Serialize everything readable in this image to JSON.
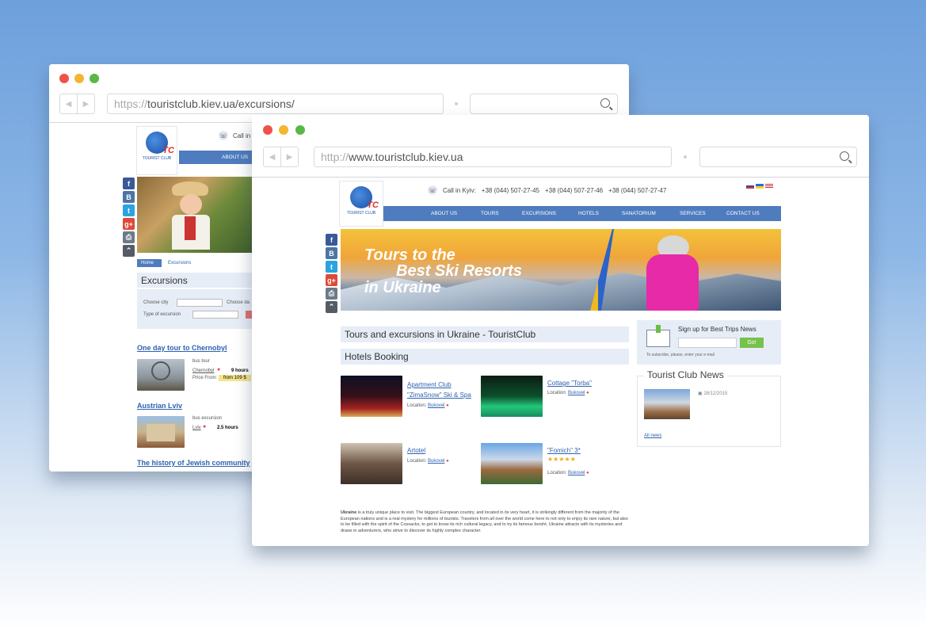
{
  "back_window": {
    "url_proto": "https://",
    "url_rest": "touristclub.kiev.ua/excursions/",
    "logo_text": "TOURIST CLUB",
    "call_label": "Call in",
    "menu": [
      "ABOUT US"
    ],
    "breadcrumb": {
      "home": "Home",
      "current": "Excursions"
    },
    "page_title": "Excursions",
    "filters": {
      "city_label": "Choose city",
      "date_label": "Choose da",
      "type_label": "Type of excursion"
    },
    "tours": [
      {
        "title": "One day tour to Chernobyl",
        "kind": "bus tour",
        "city": "Chernobyl",
        "duration": "9 hours",
        "price_label": "Price From:",
        "price": "from 109 $"
      },
      {
        "title": "Austrian Lviv",
        "kind": "bus excursion",
        "city": "Lviv",
        "duration": "2.5 hours"
      },
      {
        "title": "The history of Jewish community"
      }
    ]
  },
  "front_window": {
    "url_proto": "http://",
    "url_rest": "www.touristclub.kiev.ua",
    "logo_text": "TOURIST CLUB",
    "call_label": "Call in Kyiv:",
    "phones": [
      "+38 (044) 507-27-45",
      "+38 (044) 507-27-46",
      "+38 (044) 507-27-47"
    ],
    "menu": [
      "ABOUT US",
      "TOURS",
      "EXCURSIONS",
      "HOTELS",
      "SANATORIUM",
      "SERVICES",
      "CONTACT US"
    ],
    "banner": {
      "line1": "Tours to the",
      "line2": "Best Ski Resorts",
      "line3": "in Ukraine"
    },
    "section_title": "Tours and excursions in Ukraine - TouristClub",
    "hotels_title": "Hotels Booking",
    "hotels": [
      {
        "name": "Apartment Club \"ZimaSnow\" Ski & Spa",
        "location_label": "Location:",
        "location": "Bukovel"
      },
      {
        "name": "Cottage \"Torba\"",
        "location_label": "Location:",
        "location": "Bukovel"
      },
      {
        "name": "Artotel",
        "location_label": "Location:",
        "location": "Bukovel"
      },
      {
        "name": "\"Fomich\" 3*",
        "stars": "★★★★★",
        "location_label": "Location:",
        "location": "Bukovel"
      }
    ],
    "newsletter": {
      "title": "Sign up for Best Trips News",
      "button": "Go!",
      "hint": "To subscribe, please, enter your e-mail"
    },
    "news": {
      "title": "Tourist Club News",
      "date": "28/12/2015",
      "all": "All news"
    },
    "about": {
      "lead": "Ukraine",
      "text": " is a truly unique place to visit. The biggest European country, and located in its very heart, it is strikingly different from the majority of the European nations and is a real mystery for millions of tourists. Travelers from all over the world come here to not only to enjoy its rare nature, but also to be filled with the spirit of the Cossacks, to get to know its rich cultural legacy, and to try its famous borsht. Ukraine attracts with its mysteries and draws in adventurers, who strive to discover its highly complex character."
    }
  },
  "colors": {
    "menu": "#4f7cbf",
    "link": "#2f62b0",
    "heading_bg": "#e6edf6",
    "dot_red": "#f0524a",
    "dot_yellow": "#f5b52e",
    "dot_green": "#5ab746"
  }
}
